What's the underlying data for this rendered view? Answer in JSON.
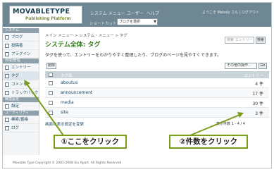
{
  "header": {
    "logo_main": "MOVABLETYPE",
    "logo_sub": "Publishing Platform",
    "links": [
      "システム メニュー",
      "ユーザー",
      "ヘルプ"
    ],
    "shortcut_label": "ショートカット",
    "blog_select_value": "ブログを選択",
    "right_links": "ようこそ Melody さん | ログアウト"
  },
  "sidebar": {
    "sections": [
      {
        "label": "システム",
        "items": [
          "ブログ",
          "投稿者",
          "プラグイン"
        ]
      },
      {
        "label": "作成/管理",
        "items": [
          "エントリー",
          "タグ",
          "コメント",
          "トラックバック"
        ]
      },
      {
        "label": "環境設定",
        "items": [
          "設定"
        ]
      },
      {
        "label": "ユーティリティ",
        "items": [
          "検索/置換",
          "ログ"
        ]
      }
    ]
  },
  "main": {
    "breadcrumb": "メイン メニュー > システム・メニュー > タグ",
    "title": "システム全体: タグ",
    "search_placeholder": "検索 エントリー",
    "search_button": "検索",
    "description": "タグを使って、エントリーをわかりやすく整理したり、ブログのページを見やすくできます。",
    "delete_button": "削除",
    "action_select": "その他の操作...",
    "go_button": "Go",
    "table": {
      "col_name": "タグ名",
      "col_count": "エントリー",
      "rows": [
        {
          "name": "aboutus",
          "count": "4 件"
        },
        {
          "name": "announcement",
          "count": "17 件"
        },
        {
          "name": "media",
          "count": "30 件"
        },
        {
          "name": "site",
          "count": "3 件"
        }
      ]
    },
    "footer_link": "画面の表示設定を変更",
    "pager": "表示件数 1 - 4 / 4"
  },
  "callouts": {
    "left": "①ここをクリック",
    "right": "②件数をクリック"
  },
  "copyright": "Movable Type Copyright © 2001-2008 Six Apart. All Rights Reserved.",
  "colors": {
    "header": "#6f8793",
    "title": "#3a7d22",
    "callout_border": "#7a9c1c"
  }
}
